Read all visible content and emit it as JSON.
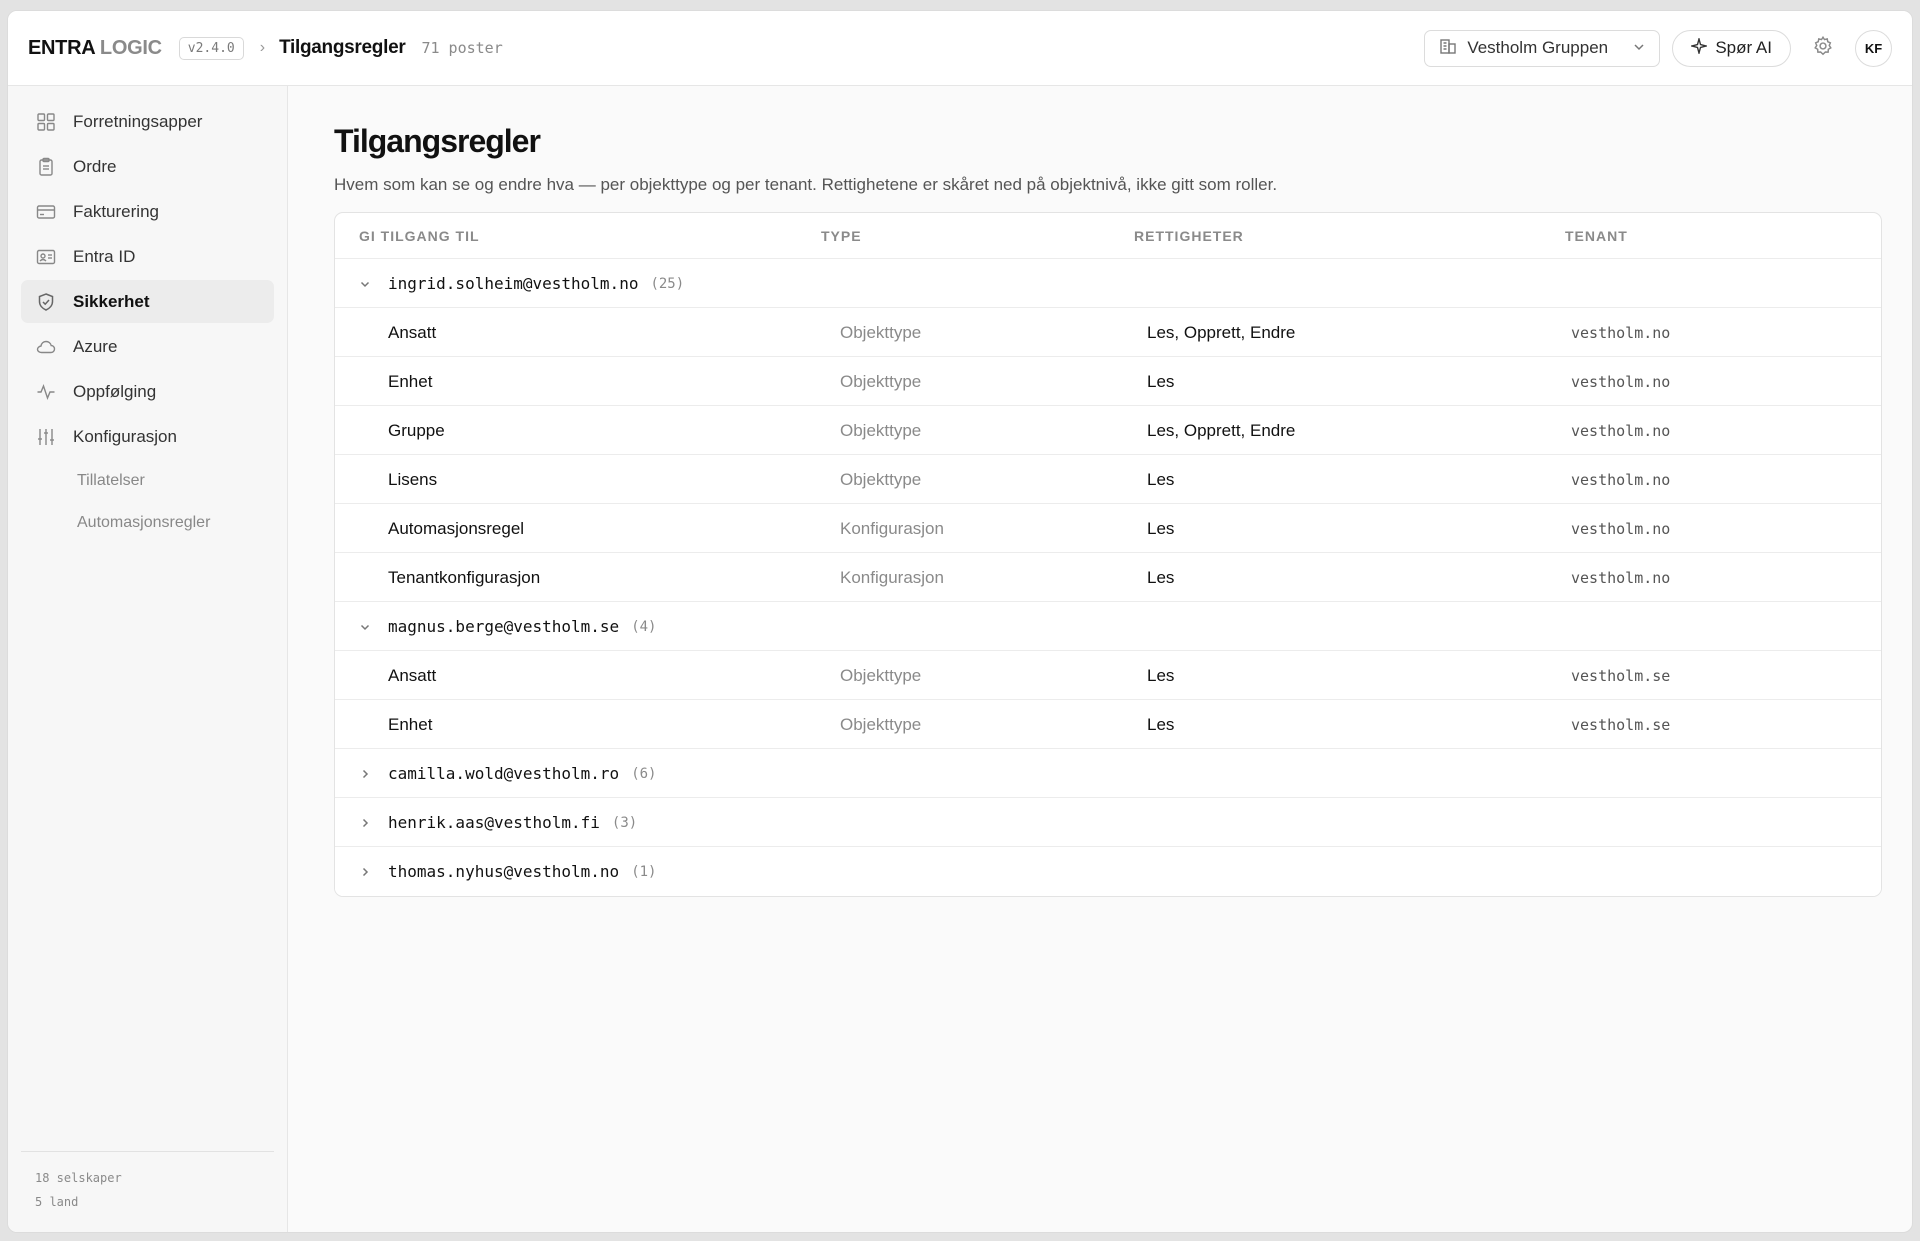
{
  "header": {
    "brand_primary": "ENTRA",
    "brand_secondary": "LOGIC",
    "version": "v2.4.0",
    "breadcrumb_title": "Tilgangsregler",
    "record_count": "71 poster",
    "tenant_select": "Vestholm Gruppen",
    "ai_button": "Spør AI",
    "avatar_initials": "KF"
  },
  "sidebar": {
    "items": [
      {
        "label": "Forretningsapper",
        "icon": "grid-icon"
      },
      {
        "label": "Ordre",
        "icon": "clipboard-icon"
      },
      {
        "label": "Fakturering",
        "icon": "credit-card-icon"
      },
      {
        "label": "Entra ID",
        "icon": "id-card-icon"
      },
      {
        "label": "Sikkerhet",
        "icon": "shield-icon",
        "active": true
      },
      {
        "label": "Azure",
        "icon": "cloud-icon"
      },
      {
        "label": "Oppfølging",
        "icon": "activity-icon"
      },
      {
        "label": "Konfigurasjon",
        "icon": "sliders-icon"
      }
    ],
    "sub_items": [
      {
        "label": "Tillatelser"
      },
      {
        "label": "Automasjonsregler"
      }
    ],
    "footer": {
      "companies": "18 selskaper",
      "countries": "5 land"
    }
  },
  "main": {
    "title": "Tilgangsregler",
    "subtitle": "Hvem som kan se og endre hva — per objekttype og per tenant. Rettighetene er skåret ned på objektnivå, ikke gitt som roller.",
    "columns": [
      "GI TILGANG TIL",
      "TYPE",
      "RETTIGHETER",
      "TENANT"
    ],
    "groups": [
      {
        "email": "ingrid.solheim@vestholm.no",
        "count": "(25)",
        "expanded": true,
        "rows": [
          {
            "name": "Ansatt",
            "type": "Objekttype",
            "rights": "Les, Opprett, Endre",
            "tenant": "vestholm.no"
          },
          {
            "name": "Enhet",
            "type": "Objekttype",
            "rights": "Les",
            "tenant": "vestholm.no"
          },
          {
            "name": "Gruppe",
            "type": "Objekttype",
            "rights": "Les, Opprett, Endre",
            "tenant": "vestholm.no"
          },
          {
            "name": "Lisens",
            "type": "Objekttype",
            "rights": "Les",
            "tenant": "vestholm.no"
          },
          {
            "name": "Automasjonsregel",
            "type": "Konfigurasjon",
            "rights": "Les",
            "tenant": "vestholm.no"
          },
          {
            "name": "Tenantkonfigurasjon",
            "type": "Konfigurasjon",
            "rights": "Les",
            "tenant": "vestholm.no"
          }
        ]
      },
      {
        "email": "magnus.berge@vestholm.se",
        "count": "(4)",
        "expanded": true,
        "rows": [
          {
            "name": "Ansatt",
            "type": "Objekttype",
            "rights": "Les",
            "tenant": "vestholm.se"
          },
          {
            "name": "Enhet",
            "type": "Objekttype",
            "rights": "Les",
            "tenant": "vestholm.se"
          }
        ]
      },
      {
        "email": "camilla.wold@vestholm.ro",
        "count": "(6)",
        "expanded": false,
        "rows": []
      },
      {
        "email": "henrik.aas@vestholm.fi",
        "count": "(3)",
        "expanded": false,
        "rows": []
      },
      {
        "email": "thomas.nyhus@vestholm.no",
        "count": "(1)",
        "expanded": false,
        "rows": []
      }
    ]
  }
}
